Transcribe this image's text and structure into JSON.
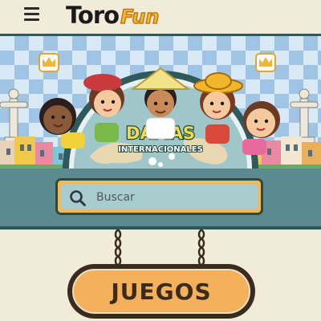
{
  "header": {
    "logo_primary": "Toro",
    "logo_secondary": "Fun"
  },
  "banner": {
    "title_line1": "DAMAS",
    "title_line2": "INTERNACIONALES"
  },
  "search": {
    "placeholder": "Buscar",
    "value": ""
  },
  "sign": {
    "label": "JUEGOS"
  },
  "icons": {
    "menu": "hamburger-menu-icon",
    "search": "magnifier-icon",
    "crown": "crown-icon"
  },
  "colors": {
    "page_bg": "#f1ecd9",
    "header_border": "#2f5a5c",
    "search_band": "#5b8b90",
    "search_frame": "#f3b955",
    "search_field": "#a9cccf",
    "sign_fill": "#f4b05b",
    "sign_border": "#3b2b1e",
    "logo_accent": "#f4b733"
  }
}
